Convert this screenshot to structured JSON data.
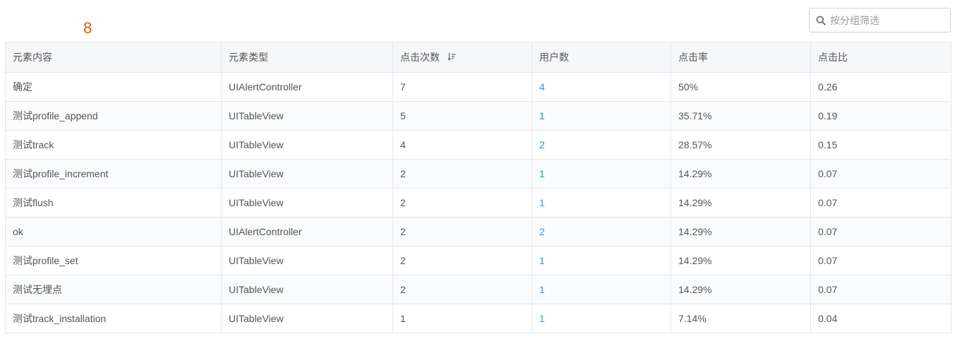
{
  "header": {
    "count": "8"
  },
  "search": {
    "placeholder": "按分组筛选",
    "value": ""
  },
  "table": {
    "columns": [
      "元素内容",
      "元素类型",
      "点击次数",
      "用户数",
      "点击率",
      "点击比"
    ],
    "sort_column": "点击次数",
    "rows": [
      [
        "确定",
        "UIAlertController",
        "7",
        "4",
        "50%",
        "0.26"
      ],
      [
        "测试profile_append",
        "UITableView",
        "5",
        "1",
        "35.71%",
        "0.19"
      ],
      [
        "测试track",
        "UITableView",
        "4",
        "2",
        "28.57%",
        "0.15"
      ],
      [
        "测试profile_increment",
        "UITableView",
        "2",
        "1",
        "14.29%",
        "0.07"
      ],
      [
        "测试flush",
        "UITableView",
        "2",
        "1",
        "14.29%",
        "0.07"
      ],
      [
        "ok",
        "UIAlertController",
        "2",
        "2",
        "14.29%",
        "0.07"
      ],
      [
        "测试profile_set",
        "UITableView",
        "2",
        "1",
        "14.29%",
        "0.07"
      ],
      [
        "测试无埋点",
        "UITableView",
        "2",
        "1",
        "14.29%",
        "0.07"
      ],
      [
        "测试track_installation",
        "UITableView",
        "1",
        "1",
        "7.14%",
        "0.04"
      ]
    ]
  },
  "colors": {
    "badge": "#e8590c",
    "link": "#3a8ee6",
    "header_bg": "#f6f7f9",
    "border": "#e3e6ea"
  },
  "icons": {
    "search": "search-icon",
    "sort": "sort-descending-icon"
  }
}
